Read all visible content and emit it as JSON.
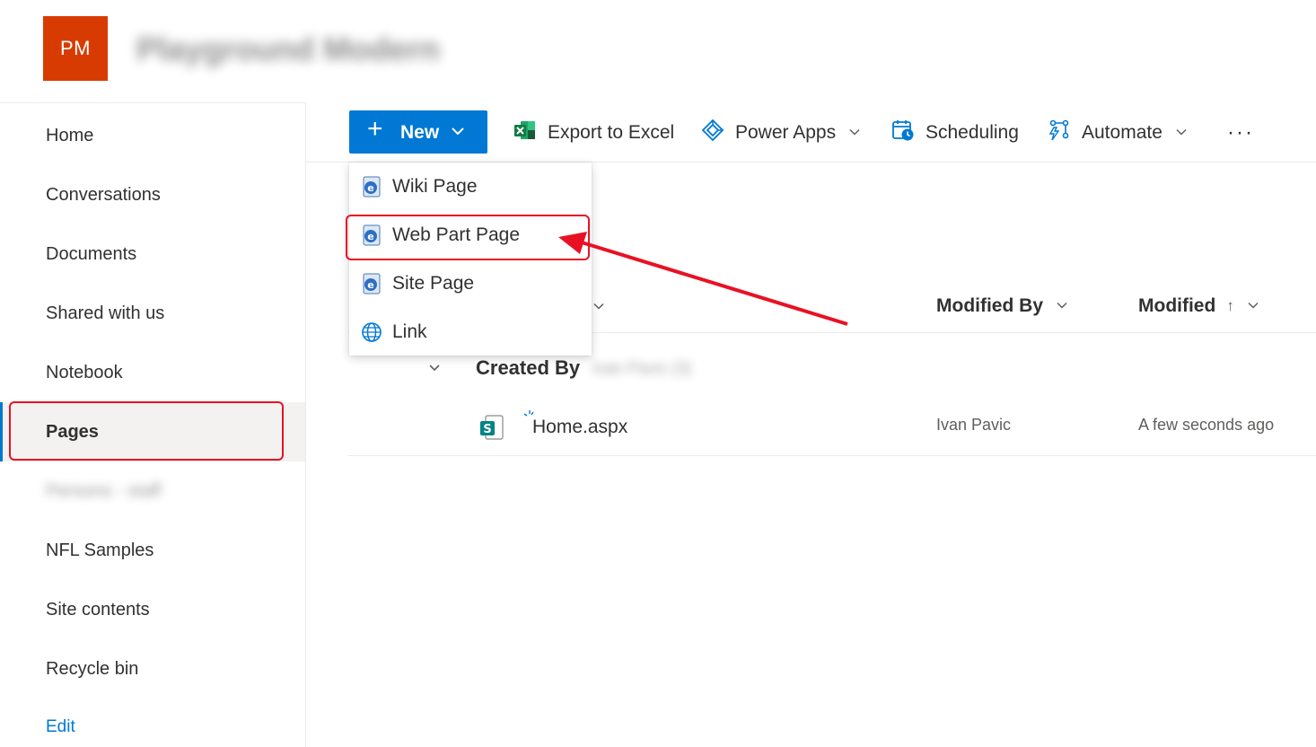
{
  "header": {
    "logo_initials": "PM",
    "site_title": "Playground Modern"
  },
  "sidebar": {
    "items": [
      {
        "label": "Home"
      },
      {
        "label": "Conversations"
      },
      {
        "label": "Documents"
      },
      {
        "label": "Shared with us"
      },
      {
        "label": "Notebook"
      },
      {
        "label": "Pages"
      },
      {
        "label": "Persons - staff"
      },
      {
        "label": "NFL Samples"
      },
      {
        "label": "Site contents"
      },
      {
        "label": "Recycle bin"
      }
    ],
    "selected": "Pages",
    "edit_label": "Edit"
  },
  "commandbar": {
    "new_label": "New",
    "export_label": "Export to Excel",
    "powerapps_label": "Power Apps",
    "scheduling_label": "Scheduling",
    "automate_label": "Automate",
    "more_label": "···"
  },
  "new_menu": {
    "items": [
      {
        "label": "Wiki Page",
        "icon": "page-icon"
      },
      {
        "label": "Web Part Page",
        "icon": "page-icon"
      },
      {
        "label": "Site Page",
        "icon": "page-icon"
      },
      {
        "label": "Link",
        "icon": "globe-icon"
      }
    ],
    "highlighted": "Web Part Page"
  },
  "list": {
    "columns": {
      "modified_by": "Modified By",
      "modified": "Modified",
      "sort_indicator": "↑"
    },
    "group": {
      "label": "Created By",
      "value": "Ivan Pavic (3)"
    },
    "rows": [
      {
        "name": "Home.aspx",
        "modified_by": "Ivan Pavic",
        "modified": "A few seconds ago"
      }
    ]
  },
  "colors": {
    "accent": "#0078d4",
    "logo": "#d83b01",
    "annotation": "#e81123"
  }
}
